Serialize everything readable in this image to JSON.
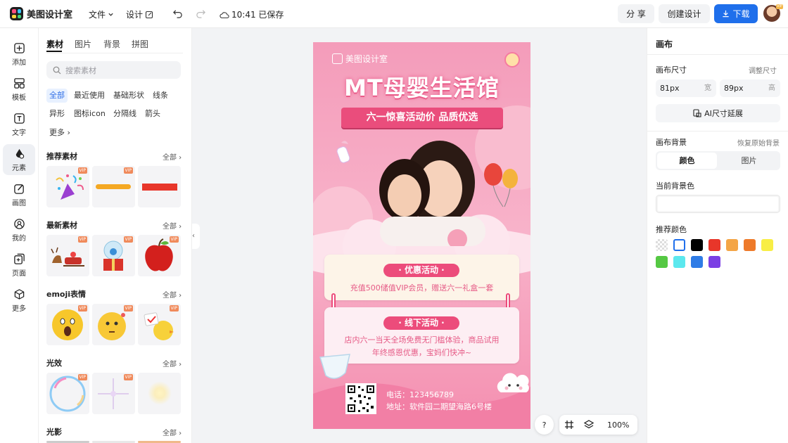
{
  "topbar": {
    "app_name": "美图设计室",
    "menu_file": "文件",
    "menu_design": "设计",
    "save_status": "10:41 已保存",
    "share": "分 享",
    "create": "创建设计",
    "download": "下载",
    "avatar_badge": "VIP"
  },
  "leftnav": {
    "items": [
      {
        "label": "添加",
        "icon": "plus-square-icon"
      },
      {
        "label": "模板",
        "icon": "template-icon"
      },
      {
        "label": "文字",
        "icon": "text-icon"
      },
      {
        "label": "元素",
        "icon": "elements-icon"
      },
      {
        "label": "画图",
        "icon": "draw-icon"
      },
      {
        "label": "我的",
        "icon": "user-icon"
      },
      {
        "label": "页面",
        "icon": "page-icon"
      },
      {
        "label": "更多",
        "icon": "cube-icon"
      }
    ],
    "active_index": 3
  },
  "panel": {
    "tabs": [
      "素材",
      "图片",
      "背景",
      "拼图"
    ],
    "search_placeholder": "搜索素材",
    "chips": [
      "全部",
      "最近使用",
      "基础形状",
      "线条",
      "异形",
      "图标icon",
      "分隔线",
      "箭头",
      "更多"
    ],
    "all_label": "全部",
    "vip": "VIP",
    "sections": [
      {
        "title": "推荐素材"
      },
      {
        "title": "最新素材"
      },
      {
        "title": "emoji表情"
      },
      {
        "title": "光效"
      },
      {
        "title": "光影"
      }
    ]
  },
  "poster": {
    "brand": "美图设计室",
    "title": "MT母婴生活馆",
    "ribbon": "六一惊喜活动价 品质优选",
    "card1_title": "· 优惠活动 ·",
    "card1_text": "充值500储值VIP会员，赠送六一礼盒一套",
    "card2_title": "· 线下活动 ·",
    "card2_text_1": "店内六一当天全场免费无门槛体验，商品试用",
    "card2_text_2": "年终感恩优惠，宝妈们快冲~",
    "phone": "电话：123456789",
    "address": "地址：软件园二期望海路6号楼"
  },
  "rightpanel": {
    "title": "画布",
    "size_label": "画布尺寸",
    "size_link": "调整尺寸",
    "width_value": "81px",
    "width_unit": "宽",
    "height_value": "89px",
    "height_unit": "高",
    "ai_extend": "AI尺寸延展",
    "bg_label": "画布背景",
    "bg_reset": "恢复原始背景",
    "bg_tab_color": "颜色",
    "bg_tab_image": "图片",
    "current_color_label": "当前背景色",
    "recommended_label": "推荐颜色",
    "colors": [
      "#ffffff",
      "#000000",
      "#e8362a",
      "#f4a546",
      "#ee7a2a",
      "#f8ee45",
      "#55c843",
      "#5ce8ee",
      "#2f7ce6",
      "#7b3fe4"
    ]
  },
  "zoom": {
    "help": "?",
    "level": "100%"
  },
  "colors": {
    "accent": "#1f6feb",
    "poster_pink": "#f7a7c1",
    "title_pink": "#f0507f"
  }
}
